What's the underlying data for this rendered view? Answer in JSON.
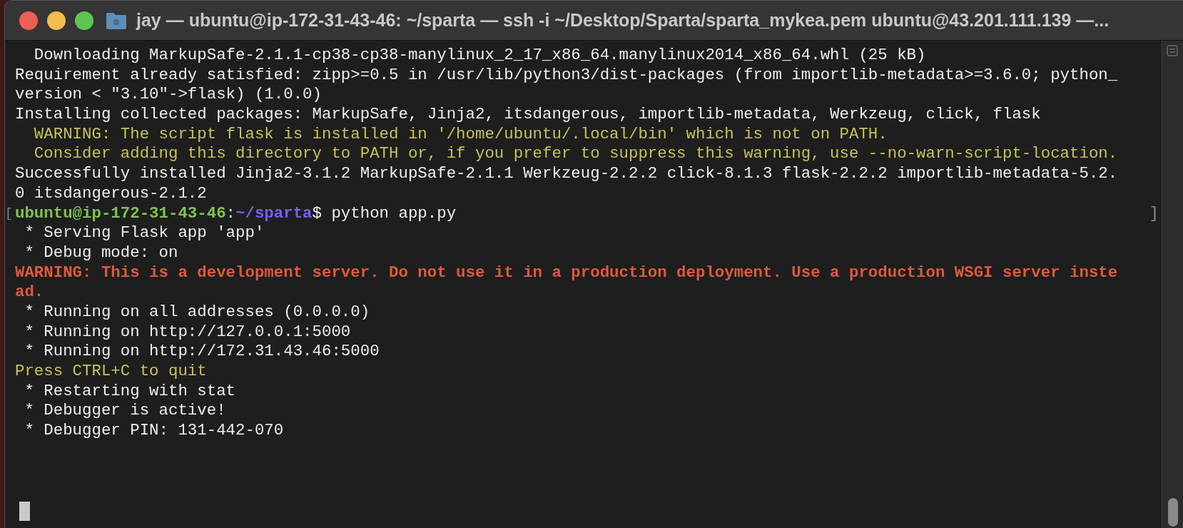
{
  "window": {
    "title": "jay — ubuntu@ip-172-31-43-46: ~/sparta — ssh -i ~/Desktop/Sparta/sparta_mykea.pem ubuntu@43.201.111.139 —..."
  },
  "terminal": {
    "lines": [
      [
        {
          "kind": "normal",
          "text": "  Downloading MarkupSafe-2.1.1-cp38-cp38-manylinux_2_17_x86_64.manylinux2014_x86_64.whl (25 kB)"
        }
      ],
      [
        {
          "kind": "normal",
          "text": "Requirement already satisfied: zipp>=0.5 in /usr/lib/python3/dist-packages (from importlib-metadata>=3.6.0; python_"
        }
      ],
      [
        {
          "kind": "normal",
          "text": "version < \"3.10\"->flask) (1.0.0)"
        }
      ],
      [
        {
          "kind": "normal",
          "text": "Installing collected packages: MarkupSafe, Jinja2, itsdangerous, importlib-metadata, Werkzeug, click, flask"
        }
      ],
      [
        {
          "kind": "warning",
          "text": "  WARNING: The script flask is installed in '/home/ubuntu/.local/bin' which is not on PATH."
        }
      ],
      [
        {
          "kind": "warning",
          "text": "  Consider adding this directory to PATH or, if you prefer to suppress this warning, use --no-warn-script-location."
        }
      ],
      [
        {
          "kind": "normal",
          "text": "Successfully installed Jinja2-3.1.2 MarkupSafe-2.1.1 Werkzeug-2.2.2 click-8.1.3 flask-2.2.2 importlib-metadata-5.2."
        }
      ],
      [
        {
          "kind": "normal",
          "text": "0 itsdangerous-2.1.2"
        }
      ],
      [
        {
          "kind": "mark",
          "text": "["
        },
        {
          "kind": "host",
          "text": "ubuntu@ip-172-31-43-46"
        },
        {
          "kind": "normal",
          "text": ":"
        },
        {
          "kind": "path",
          "text": "~/sparta"
        },
        {
          "kind": "normal",
          "text": "$ python app.py"
        },
        {
          "kind": "endmark",
          "text": "]"
        }
      ],
      [
        {
          "kind": "normal",
          "text": " * Serving Flask app 'app'"
        }
      ],
      [
        {
          "kind": "normal",
          "text": " * Debug mode: on"
        }
      ],
      [
        {
          "kind": "error",
          "text": "WARNING: This is a development server. Do not use it in a production deployment. Use a production WSGI server inste"
        }
      ],
      [
        {
          "kind": "error",
          "text": "ad."
        }
      ],
      [
        {
          "kind": "normal",
          "text": " * Running on all addresses (0.0.0.0)"
        }
      ],
      [
        {
          "kind": "normal",
          "text": " * Running on http://127.0.0.1:5000"
        }
      ],
      [
        {
          "kind": "normal",
          "text": " * Running on http://172.31.43.46:5000"
        }
      ],
      [
        {
          "kind": "warning",
          "text": "Press CTRL+C to quit"
        }
      ],
      [
        {
          "kind": "normal",
          "text": " * Restarting with stat"
        }
      ],
      [
        {
          "kind": "normal",
          "text": " * Debugger is active!"
        }
      ],
      [
        {
          "kind": "normal",
          "text": " * Debugger PIN: 131-442-070"
        }
      ]
    ]
  }
}
